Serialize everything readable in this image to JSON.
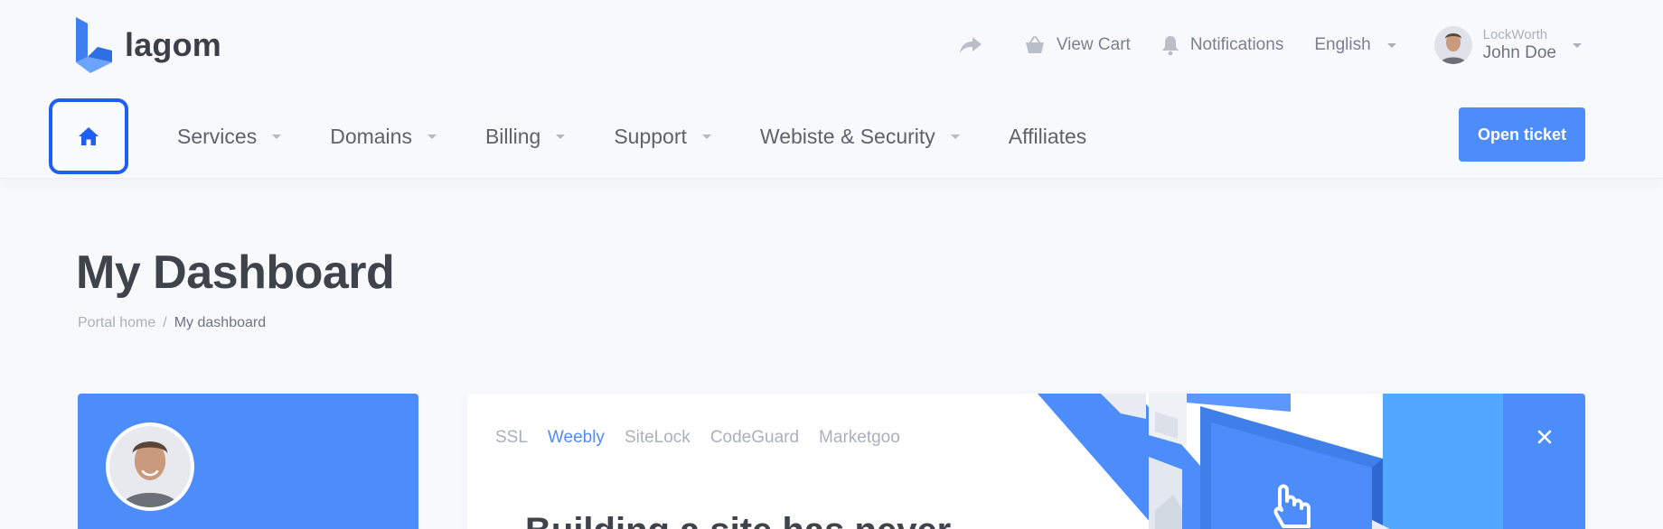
{
  "brand": {
    "name": "lagom",
    "color": "#4d8cfb"
  },
  "topbar": {
    "share_icon": "share-arrow-icon",
    "view_cart": "View Cart",
    "notifications": "Notifications",
    "language": "English",
    "user": {
      "company": "LockWorth",
      "name": "John Doe"
    }
  },
  "nav": {
    "home_icon": "home-icon",
    "items": [
      {
        "label": "Services",
        "has_dropdown": true
      },
      {
        "label": "Domains",
        "has_dropdown": true
      },
      {
        "label": "Billing",
        "has_dropdown": true
      },
      {
        "label": "Support",
        "has_dropdown": true
      },
      {
        "label": "Webiste & Security",
        "has_dropdown": true
      },
      {
        "label": "Affiliates",
        "has_dropdown": false
      }
    ],
    "open_ticket": "Open ticket"
  },
  "page": {
    "title": "My Dashboard",
    "breadcrumb": {
      "home": "Portal home",
      "separator": "/",
      "current": "My dashboard"
    }
  },
  "promo": {
    "tabs": [
      {
        "label": "SSL",
        "active": false
      },
      {
        "label": "Weebly",
        "active": true
      },
      {
        "label": "SiteLock",
        "active": false
      },
      {
        "label": "CodeGuard",
        "active": false
      },
      {
        "label": "Marketgoo",
        "active": false
      }
    ],
    "headline": "Building a site has never",
    "close_icon": "close-icon"
  },
  "colors": {
    "accent": "#4d8cfb",
    "highlight": "#1e5ef3",
    "background": "#f8f9fc"
  }
}
